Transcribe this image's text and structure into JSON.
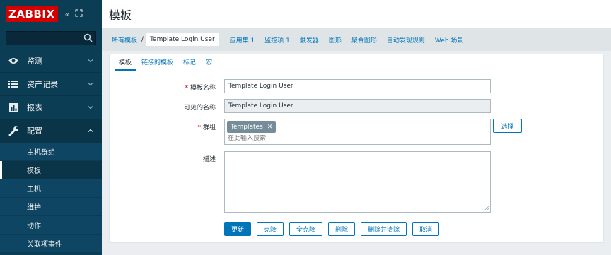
{
  "sidebar": {
    "logo": "ZABBIX",
    "search": {
      "value": "",
      "placeholder": ""
    },
    "menu": [
      {
        "label": "监测",
        "icon": "eye-icon",
        "expanded": false
      },
      {
        "label": "资产记录",
        "icon": "list-icon",
        "expanded": false
      },
      {
        "label": "报表",
        "icon": "bar-chart-icon",
        "expanded": false
      },
      {
        "label": "配置",
        "icon": "wrench-icon",
        "expanded": true
      }
    ],
    "submenu": [
      {
        "label": "主机群组",
        "selected": false
      },
      {
        "label": "模板",
        "selected": true
      },
      {
        "label": "主机",
        "selected": false
      },
      {
        "label": "维护",
        "selected": false
      },
      {
        "label": "动作",
        "selected": false
      },
      {
        "label": "关联项事件",
        "selected": false
      }
    ]
  },
  "header": {
    "title": "模板"
  },
  "breadcrumb": {
    "all_templates": "所有模板",
    "current": "Template Login User",
    "links": [
      "应用集 1",
      "监控项 1",
      "触发器",
      "图形",
      "聚合图形",
      "自动发现规则",
      "Web 场景"
    ]
  },
  "tabs": [
    {
      "label": "模板",
      "active": true
    },
    {
      "label": "链接的模板",
      "active": false
    },
    {
      "label": "标记",
      "active": false
    },
    {
      "label": "宏",
      "active": false
    }
  ],
  "form": {
    "template_name": {
      "label": "模板名称",
      "required": true,
      "value": "Template Login User"
    },
    "visible_name": {
      "label": "可见的名称",
      "required": false,
      "value": "Template Login User"
    },
    "groups": {
      "label": "群组",
      "required": true,
      "chip": "Templates",
      "placeholder": "在此输入搜索",
      "select_label": "选择"
    },
    "description": {
      "label": "描述",
      "value": ""
    }
  },
  "buttons": {
    "update": "更新",
    "clone": "克隆",
    "full_clone": "全克隆",
    "delete": "删除",
    "delete_and_clear": "删除并清除",
    "cancel": "取消"
  },
  "colors": {
    "sidebar_bg": "#0b3d54",
    "logo_red": "#d40000",
    "accent_blue": "#0275b8",
    "page_bg": "#ebeef0"
  }
}
